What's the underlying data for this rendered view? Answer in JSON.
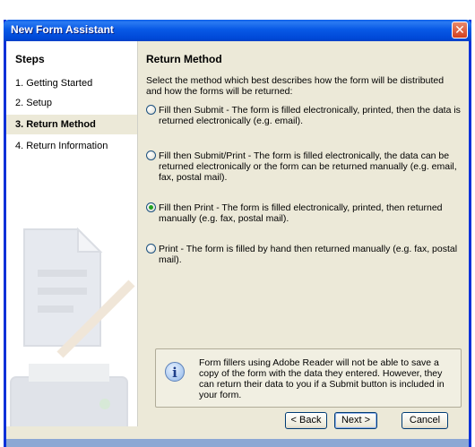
{
  "window": {
    "title": "New Form Assistant",
    "close_symbol": "✕"
  },
  "sidebar": {
    "heading": "Steps",
    "items": [
      {
        "label": "1. Getting Started"
      },
      {
        "label": "2. Setup"
      },
      {
        "label": "3. Return Method"
      },
      {
        "label": "4. Return Information"
      }
    ]
  },
  "main": {
    "heading": "Return Method",
    "intro": "Select the method which best describes how the form will be distributed and how the forms will be returned:",
    "options": [
      {
        "label": "Fill then Submit  -  The form is filled electronically, printed, then the data is returned electronically (e.g. email).",
        "checked": false
      },
      {
        "label": "Fill then Submit/Print  -  The form is filled electronically, the data can be returned electronically or the form can be returned manually (e.g. email, fax, postal mail).",
        "checked": false
      },
      {
        "label": "Fill then Print  -  The form is filled electronically, printed, then returned manually (e.g. fax, postal mail).",
        "checked": true
      },
      {
        "label": "Print  -  The form is filled by hand then returned manually (e.g. fax, postal mail).",
        "checked": false
      }
    ],
    "info": {
      "icon": "info-icon",
      "text": "Form fillers using Adobe Reader will not be able to save a copy of the form with the data they entered.  However, they can return their data to you if a Submit button is included in your form."
    }
  },
  "buttons": {
    "back": "< Back",
    "next": "Next >",
    "cancel": "Cancel"
  },
  "colors": {
    "titlebar": "#0859e6",
    "dialog_bg": "#ece9d8",
    "radio_dot": "#21a121"
  }
}
